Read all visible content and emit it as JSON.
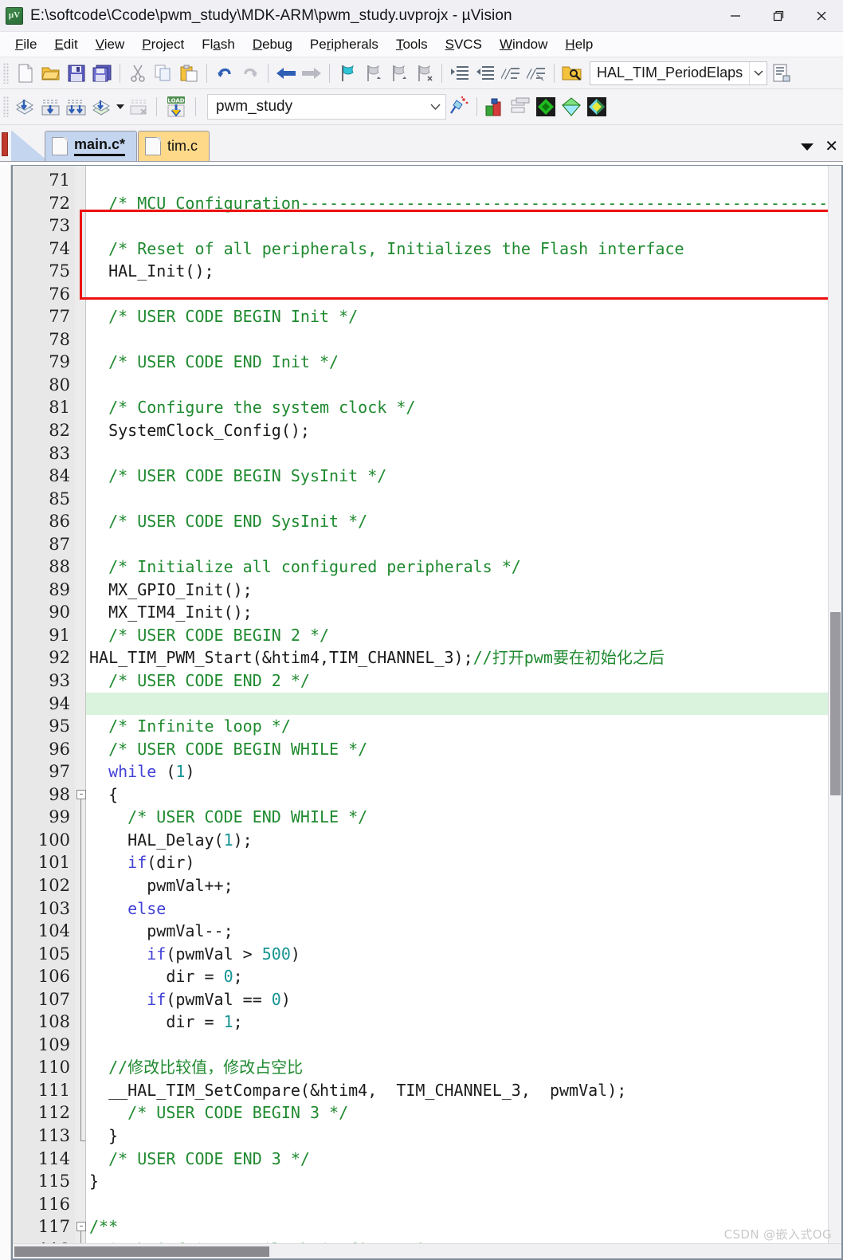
{
  "window": {
    "title": "E:\\softcode\\Ccode\\pwm_study\\MDK-ARM\\pwm_study.uvprojx - µVision",
    "app_icon_text": "μV",
    "minimize": "—",
    "maximize": "❐",
    "close": "✕"
  },
  "menu": [
    {
      "pre": "",
      "hot": "F",
      "post": "ile"
    },
    {
      "pre": "",
      "hot": "E",
      "post": "dit"
    },
    {
      "pre": "",
      "hot": "V",
      "post": "iew"
    },
    {
      "pre": "",
      "hot": "P",
      "post": "roject"
    },
    {
      "pre": "Fl",
      "hot": "a",
      "post": "sh"
    },
    {
      "pre": "",
      "hot": "D",
      "post": "ebug"
    },
    {
      "pre": "Pe",
      "hot": "r",
      "post": "ipherals"
    },
    {
      "pre": "",
      "hot": "T",
      "post": "ools"
    },
    {
      "pre": "",
      "hot": "S",
      "post": "VCS"
    },
    {
      "pre": "",
      "hot": "W",
      "post": "indow"
    },
    {
      "pre": "",
      "hot": "H",
      "post": "elp"
    }
  ],
  "toolbar1": {
    "icons": [
      "new-file-icon",
      "open-file-icon",
      "save-icon",
      "save-all-icon",
      "cut-icon",
      "copy-icon",
      "paste-icon",
      "undo-icon",
      "redo-icon",
      "navigate-back-icon",
      "navigate-forward-icon",
      "bookmark-toggle-icon",
      "bookmark-prev-icon",
      "bookmark-next-icon",
      "bookmark-clear-icon",
      "indent-right-icon",
      "indent-left-icon",
      "comment-icon",
      "uncomment-icon",
      "find-in-files-icon"
    ],
    "function_combo_value": "HAL_TIM_PeriodElaps",
    "right_icon": "configure-target-icon"
  },
  "toolbar2": {
    "icons": [
      "translate-icon",
      "build-icon",
      "rebuild-icon",
      "batch-build-icon",
      "stop-build-icon",
      "load-icon"
    ],
    "project_combo_value": "pwm_study",
    "after_icons": [
      "target-options-icon",
      "manage-runtime-icon",
      "manage-project-items-icon",
      "books-icon",
      "pack-installer-icon",
      "manage-pack-icon"
    ]
  },
  "tabs": [
    {
      "label": "main.c*",
      "state": "active"
    },
    {
      "label": "tim.c",
      "state": "modified"
    }
  ],
  "tab_controls": {
    "dropdown": "▼",
    "close": "✕"
  },
  "editor": {
    "first_line": 71,
    "highlight_line": 94,
    "lines": [
      {
        "n": 71,
        "tokens": [
          {
            "t": "",
            "c": ""
          }
        ]
      },
      {
        "n": 72,
        "tokens": [
          {
            "t": "  /* MCU Configuration--------------------------------------------------------",
            "c": "cm"
          }
        ]
      },
      {
        "n": 73,
        "tokens": [
          {
            "t": "",
            "c": ""
          }
        ]
      },
      {
        "n": 74,
        "tokens": [
          {
            "t": "  /* Reset of all peripherals, Initializes the Flash interface",
            "c": "cm"
          }
        ]
      },
      {
        "n": 75,
        "tokens": [
          {
            "t": "  HAL_Init();",
            "c": ""
          }
        ]
      },
      {
        "n": 76,
        "tokens": [
          {
            "t": "",
            "c": ""
          }
        ]
      },
      {
        "n": 77,
        "tokens": [
          {
            "t": "  /* USER CODE BEGIN Init */",
            "c": "cm"
          }
        ]
      },
      {
        "n": 78,
        "tokens": [
          {
            "t": "",
            "c": ""
          }
        ]
      },
      {
        "n": 79,
        "tokens": [
          {
            "t": "  /* USER CODE END Init */",
            "c": "cm"
          }
        ]
      },
      {
        "n": 80,
        "tokens": [
          {
            "t": "",
            "c": ""
          }
        ]
      },
      {
        "n": 81,
        "tokens": [
          {
            "t": "  /* Configure the system clock */",
            "c": "cm"
          }
        ]
      },
      {
        "n": 82,
        "tokens": [
          {
            "t": "  SystemClock_Config();",
            "c": ""
          }
        ]
      },
      {
        "n": 83,
        "tokens": [
          {
            "t": "",
            "c": ""
          }
        ]
      },
      {
        "n": 84,
        "tokens": [
          {
            "t": "  /* USER CODE BEGIN SysInit */",
            "c": "cm"
          }
        ]
      },
      {
        "n": 85,
        "tokens": [
          {
            "t": "",
            "c": ""
          }
        ]
      },
      {
        "n": 86,
        "tokens": [
          {
            "t": "  /* USER CODE END SysInit */",
            "c": "cm"
          }
        ]
      },
      {
        "n": 87,
        "tokens": [
          {
            "t": "",
            "c": ""
          }
        ]
      },
      {
        "n": 88,
        "tokens": [
          {
            "t": "  /* Initialize all configured peripherals */",
            "c": "cm"
          }
        ]
      },
      {
        "n": 89,
        "tokens": [
          {
            "t": "  MX_GPIO_Init();",
            "c": ""
          }
        ]
      },
      {
        "n": 90,
        "tokens": [
          {
            "t": "  MX_TIM4_Init();",
            "c": ""
          }
        ]
      },
      {
        "n": 91,
        "tokens": [
          {
            "t": "  /* USER CODE BEGIN 2 */",
            "c": "cm"
          }
        ]
      },
      {
        "n": 92,
        "tokens": [
          {
            "t": "HAL_TIM_PWM_Start(&htim4,TIM_CHANNEL_3);",
            "c": ""
          },
          {
            "t": "//",
            "c": "cm"
          },
          {
            "t": "打开",
            "c": "cn"
          },
          {
            "t": "pwm",
            "c": "cm"
          },
          {
            "t": "要在初始化之后",
            "c": "cn"
          }
        ]
      },
      {
        "n": 93,
        "tokens": [
          {
            "t": "  /* USER CODE END 2 */",
            "c": "cm"
          }
        ]
      },
      {
        "n": 94,
        "tokens": [
          {
            "t": "",
            "c": ""
          }
        ]
      },
      {
        "n": 95,
        "tokens": [
          {
            "t": "  /* Infinite loop */",
            "c": "cm"
          }
        ]
      },
      {
        "n": 96,
        "tokens": [
          {
            "t": "  /* USER CODE BEGIN WHILE */",
            "c": "cm"
          }
        ]
      },
      {
        "n": 97,
        "tokens": [
          {
            "t": "  ",
            "c": ""
          },
          {
            "t": "while",
            "c": "kw"
          },
          {
            "t": " (",
            "c": ""
          },
          {
            "t": "1",
            "c": "num"
          },
          {
            "t": ")",
            "c": ""
          }
        ]
      },
      {
        "n": 98,
        "tokens": [
          {
            "t": "  {",
            "c": ""
          }
        ]
      },
      {
        "n": 99,
        "tokens": [
          {
            "t": "    /* USER CODE END WHILE */",
            "c": "cm"
          }
        ]
      },
      {
        "n": 100,
        "tokens": [
          {
            "t": "    HAL_Delay(",
            "c": ""
          },
          {
            "t": "1",
            "c": "num"
          },
          {
            "t": ");",
            "c": ""
          }
        ]
      },
      {
        "n": 101,
        "tokens": [
          {
            "t": "    ",
            "c": ""
          },
          {
            "t": "if",
            "c": "kw"
          },
          {
            "t": "(dir)",
            "c": ""
          }
        ]
      },
      {
        "n": 102,
        "tokens": [
          {
            "t": "      pwmVal++;",
            "c": ""
          }
        ]
      },
      {
        "n": 103,
        "tokens": [
          {
            "t": "    ",
            "c": ""
          },
          {
            "t": "else",
            "c": "kw"
          }
        ]
      },
      {
        "n": 104,
        "tokens": [
          {
            "t": "      pwmVal--;",
            "c": ""
          }
        ]
      },
      {
        "n": 105,
        "tokens": [
          {
            "t": "      ",
            "c": ""
          },
          {
            "t": "if",
            "c": "kw"
          },
          {
            "t": "(pwmVal > ",
            "c": ""
          },
          {
            "t": "500",
            "c": "num"
          },
          {
            "t": ")",
            "c": ""
          }
        ]
      },
      {
        "n": 106,
        "tokens": [
          {
            "t": "        dir = ",
            "c": ""
          },
          {
            "t": "0",
            "c": "num"
          },
          {
            "t": ";",
            "c": ""
          }
        ]
      },
      {
        "n": 107,
        "tokens": [
          {
            "t": "      ",
            "c": ""
          },
          {
            "t": "if",
            "c": "kw"
          },
          {
            "t": "(pwmVal == ",
            "c": ""
          },
          {
            "t": "0",
            "c": "num"
          },
          {
            "t": ")",
            "c": ""
          }
        ]
      },
      {
        "n": 108,
        "tokens": [
          {
            "t": "        dir = ",
            "c": ""
          },
          {
            "t": "1",
            "c": "num"
          },
          {
            "t": ";",
            "c": ""
          }
        ]
      },
      {
        "n": 109,
        "tokens": [
          {
            "t": "",
            "c": ""
          }
        ]
      },
      {
        "n": 110,
        "tokens": [
          {
            "t": "  //",
            "c": "cm"
          },
          {
            "t": "修改比较值，修改占空比",
            "c": "cn"
          }
        ]
      },
      {
        "n": 111,
        "tokens": [
          {
            "t": "  __HAL_TIM_SetCompare(&htim4,  TIM_CHANNEL_3,  pwmVal);",
            "c": ""
          }
        ]
      },
      {
        "n": 112,
        "tokens": [
          {
            "t": "    /* USER CODE BEGIN 3 */",
            "c": "cm"
          }
        ]
      },
      {
        "n": 113,
        "tokens": [
          {
            "t": "  }",
            "c": ""
          }
        ]
      },
      {
        "n": 114,
        "tokens": [
          {
            "t": "  /* USER CODE END 3 */",
            "c": "cm"
          }
        ]
      },
      {
        "n": 115,
        "tokens": [
          {
            "t": "}",
            "c": ""
          }
        ]
      },
      {
        "n": 116,
        "tokens": [
          {
            "t": "",
            "c": ""
          }
        ]
      },
      {
        "n": 117,
        "tokens": [
          {
            "t": "/**",
            "c": "cm"
          }
        ]
      },
      {
        "n": 118,
        "tokens": [
          {
            "t": "  * @brief System Clock Configuration",
            "c": "cm"
          }
        ]
      }
    ]
  },
  "annotation": {
    "type": "red-rectangle",
    "covers_lines": "91-94"
  },
  "watermark": "CSDN @嵌入式OG"
}
